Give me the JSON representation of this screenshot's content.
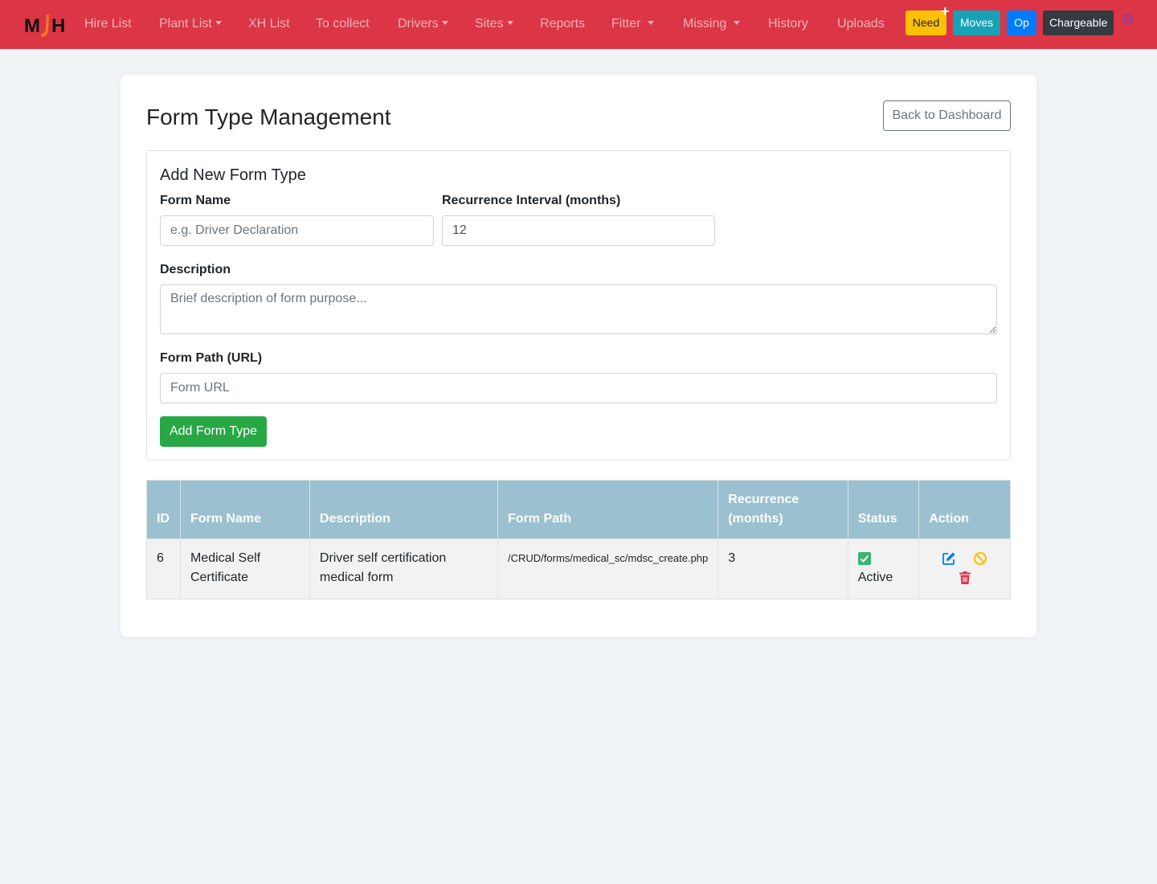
{
  "nav": {
    "links": [
      {
        "label": "Hire List"
      },
      {
        "label": "Plant List"
      },
      {
        "label": "XH List"
      },
      {
        "label": "To collect"
      },
      {
        "label": "Drivers"
      },
      {
        "label": "Sites"
      },
      {
        "label": "Reports"
      },
      {
        "label": "Fitter"
      },
      {
        "label": "Missing"
      },
      {
        "label": "History"
      },
      {
        "label": "Uploads"
      }
    ],
    "buttons": [
      {
        "label": "Need",
        "color": "#ffc107"
      },
      {
        "label": "Moves",
        "color": "#17a2b8"
      },
      {
        "label": "Op",
        "color": "#007bff"
      },
      {
        "label": "Chargeable",
        "color": "#343a40"
      }
    ],
    "plus_mark": "+",
    "colors": {
      "navbar": "#dc3545"
    }
  },
  "page": {
    "title": "Form Type Management",
    "back_button": "Back to Dashboard"
  },
  "form": {
    "heading": "Add New Form Type",
    "name_label": "Form Name",
    "name_placeholder": "e.g. Driver Declaration",
    "recurrence_label": "Recurrence Interval (months)",
    "recurrence_value": "12",
    "description_label": "Description",
    "description_placeholder": "Brief description of form purpose...",
    "path_label": "Form Path (URL)",
    "path_placeholder": "Form URL",
    "submit_label": "Add Form Type"
  },
  "table": {
    "headers": {
      "id": "ID",
      "name": "Form Name",
      "description": "Description",
      "path": "Form Path",
      "recurrence": "Recurrence (months)",
      "status": "Status",
      "action": "Action"
    },
    "rows": [
      {
        "id": "6",
        "name": "Medical Self Certificate",
        "description": "Driver self certification medical form",
        "path": "/CRUD/forms/medical_sc/mdsc_create.php",
        "recurrence": "3",
        "status": "Active"
      }
    ]
  },
  "icons": {
    "status": "check-square-icon",
    "edit": "edit-icon",
    "disable": "ban-icon",
    "delete": "trash-icon",
    "history": "history-icon"
  }
}
